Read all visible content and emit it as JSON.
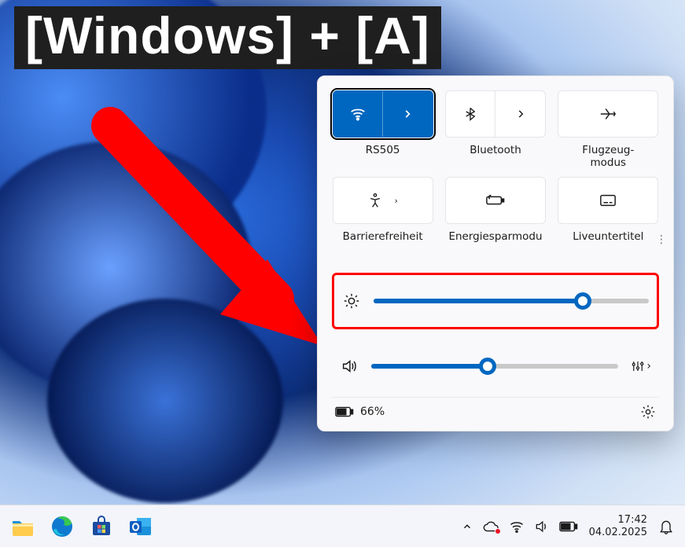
{
  "overlay": {
    "shortcut": "[Windows] + [A]"
  },
  "panel": {
    "tiles": [
      {
        "label": "RS505"
      },
      {
        "label": "Bluetooth"
      },
      {
        "label": "Flugzeug-\nmodus"
      },
      {
        "label": "Barrierefreiheit"
      },
      {
        "label": "Energiesparmodu"
      },
      {
        "label": "Liveuntertitel"
      }
    ],
    "brightness": {
      "value": 76
    },
    "volume": {
      "value": 47
    },
    "battery": {
      "text": "66%"
    }
  },
  "taskbar": {
    "clock": {
      "time": "17:42",
      "date": "04.02.2025"
    }
  }
}
